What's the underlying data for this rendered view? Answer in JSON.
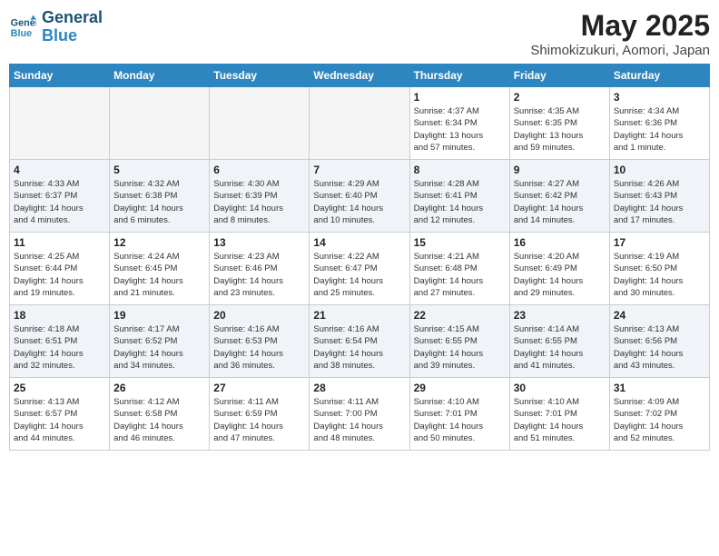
{
  "header": {
    "logo_line1": "General",
    "logo_line2": "Blue",
    "title": "May 2025",
    "subtitle": "Shimokizukuri, Aomori, Japan"
  },
  "days_of_week": [
    "Sunday",
    "Monday",
    "Tuesday",
    "Wednesday",
    "Thursday",
    "Friday",
    "Saturday"
  ],
  "weeks": [
    [
      {
        "date": "",
        "info": ""
      },
      {
        "date": "",
        "info": ""
      },
      {
        "date": "",
        "info": ""
      },
      {
        "date": "",
        "info": ""
      },
      {
        "date": "1",
        "info": "Sunrise: 4:37 AM\nSunset: 6:34 PM\nDaylight: 13 hours\nand 57 minutes."
      },
      {
        "date": "2",
        "info": "Sunrise: 4:35 AM\nSunset: 6:35 PM\nDaylight: 13 hours\nand 59 minutes."
      },
      {
        "date": "3",
        "info": "Sunrise: 4:34 AM\nSunset: 6:36 PM\nDaylight: 14 hours\nand 1 minute."
      }
    ],
    [
      {
        "date": "4",
        "info": "Sunrise: 4:33 AM\nSunset: 6:37 PM\nDaylight: 14 hours\nand 4 minutes."
      },
      {
        "date": "5",
        "info": "Sunrise: 4:32 AM\nSunset: 6:38 PM\nDaylight: 14 hours\nand 6 minutes."
      },
      {
        "date": "6",
        "info": "Sunrise: 4:30 AM\nSunset: 6:39 PM\nDaylight: 14 hours\nand 8 minutes."
      },
      {
        "date": "7",
        "info": "Sunrise: 4:29 AM\nSunset: 6:40 PM\nDaylight: 14 hours\nand 10 minutes."
      },
      {
        "date": "8",
        "info": "Sunrise: 4:28 AM\nSunset: 6:41 PM\nDaylight: 14 hours\nand 12 minutes."
      },
      {
        "date": "9",
        "info": "Sunrise: 4:27 AM\nSunset: 6:42 PM\nDaylight: 14 hours\nand 14 minutes."
      },
      {
        "date": "10",
        "info": "Sunrise: 4:26 AM\nSunset: 6:43 PM\nDaylight: 14 hours\nand 17 minutes."
      }
    ],
    [
      {
        "date": "11",
        "info": "Sunrise: 4:25 AM\nSunset: 6:44 PM\nDaylight: 14 hours\nand 19 minutes."
      },
      {
        "date": "12",
        "info": "Sunrise: 4:24 AM\nSunset: 6:45 PM\nDaylight: 14 hours\nand 21 minutes."
      },
      {
        "date": "13",
        "info": "Sunrise: 4:23 AM\nSunset: 6:46 PM\nDaylight: 14 hours\nand 23 minutes."
      },
      {
        "date": "14",
        "info": "Sunrise: 4:22 AM\nSunset: 6:47 PM\nDaylight: 14 hours\nand 25 minutes."
      },
      {
        "date": "15",
        "info": "Sunrise: 4:21 AM\nSunset: 6:48 PM\nDaylight: 14 hours\nand 27 minutes."
      },
      {
        "date": "16",
        "info": "Sunrise: 4:20 AM\nSunset: 6:49 PM\nDaylight: 14 hours\nand 29 minutes."
      },
      {
        "date": "17",
        "info": "Sunrise: 4:19 AM\nSunset: 6:50 PM\nDaylight: 14 hours\nand 30 minutes."
      }
    ],
    [
      {
        "date": "18",
        "info": "Sunrise: 4:18 AM\nSunset: 6:51 PM\nDaylight: 14 hours\nand 32 minutes."
      },
      {
        "date": "19",
        "info": "Sunrise: 4:17 AM\nSunset: 6:52 PM\nDaylight: 14 hours\nand 34 minutes."
      },
      {
        "date": "20",
        "info": "Sunrise: 4:16 AM\nSunset: 6:53 PM\nDaylight: 14 hours\nand 36 minutes."
      },
      {
        "date": "21",
        "info": "Sunrise: 4:16 AM\nSunset: 6:54 PM\nDaylight: 14 hours\nand 38 minutes."
      },
      {
        "date": "22",
        "info": "Sunrise: 4:15 AM\nSunset: 6:55 PM\nDaylight: 14 hours\nand 39 minutes."
      },
      {
        "date": "23",
        "info": "Sunrise: 4:14 AM\nSunset: 6:55 PM\nDaylight: 14 hours\nand 41 minutes."
      },
      {
        "date": "24",
        "info": "Sunrise: 4:13 AM\nSunset: 6:56 PM\nDaylight: 14 hours\nand 43 minutes."
      }
    ],
    [
      {
        "date": "25",
        "info": "Sunrise: 4:13 AM\nSunset: 6:57 PM\nDaylight: 14 hours\nand 44 minutes."
      },
      {
        "date": "26",
        "info": "Sunrise: 4:12 AM\nSunset: 6:58 PM\nDaylight: 14 hours\nand 46 minutes."
      },
      {
        "date": "27",
        "info": "Sunrise: 4:11 AM\nSunset: 6:59 PM\nDaylight: 14 hours\nand 47 minutes."
      },
      {
        "date": "28",
        "info": "Sunrise: 4:11 AM\nSunset: 7:00 PM\nDaylight: 14 hours\nand 48 minutes."
      },
      {
        "date": "29",
        "info": "Sunrise: 4:10 AM\nSunset: 7:01 PM\nDaylight: 14 hours\nand 50 minutes."
      },
      {
        "date": "30",
        "info": "Sunrise: 4:10 AM\nSunset: 7:01 PM\nDaylight: 14 hours\nand 51 minutes."
      },
      {
        "date": "31",
        "info": "Sunrise: 4:09 AM\nSunset: 7:02 PM\nDaylight: 14 hours\nand 52 minutes."
      }
    ]
  ]
}
